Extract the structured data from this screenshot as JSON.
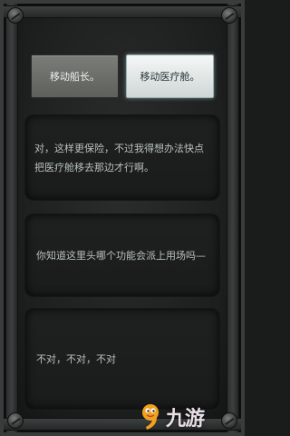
{
  "choices": {
    "left_label": "移动船长。",
    "right_label": "移动医疗舱。"
  },
  "dialog": {
    "line1": "对，这样更保险，不过我得想办法快点把医疗舱移去那边才行啊。",
    "line2": "你知道这里头哪个功能会派上用场吗—",
    "line3": "不对，不对，不对"
  },
  "watermark": {
    "text": "九游"
  },
  "colors": {
    "panel_text": "#b9c1c0",
    "selected_button": "#e6ecea",
    "unselected_button": "#6d6f6a",
    "logo_orange": "#f2a11c"
  }
}
